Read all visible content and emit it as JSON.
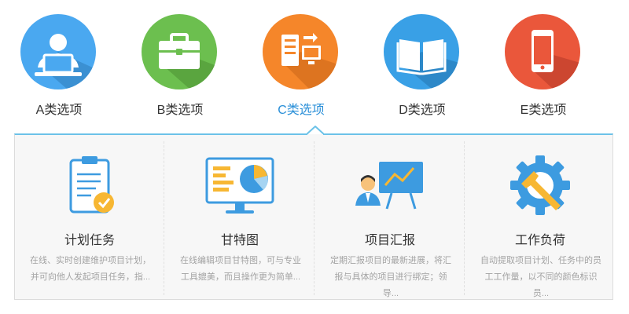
{
  "tabs": [
    {
      "label": "A类选项",
      "icon": "user-laptop-icon",
      "color": "#4aa8f0"
    },
    {
      "label": "B类选项",
      "icon": "briefcase-icon",
      "color": "#6cbf4f"
    },
    {
      "label": "C类选项",
      "icon": "server-monitor-icon",
      "color": "#f5862a",
      "active": true
    },
    {
      "label": "D类选项",
      "icon": "book-icon",
      "color": "#39a0e6"
    },
    {
      "label": "E类选项",
      "icon": "phone-icon",
      "color": "#ea573b"
    }
  ],
  "cards": [
    {
      "title": "计划任务",
      "desc": "在线、实时创建维护项目计划，并可向他人发起项目任务，指...",
      "icon": "clipboard-check-icon"
    },
    {
      "title": "甘特图",
      "desc": "在线编辑项目甘特图，可与专业工具媲美，而且操作更为简单...",
      "icon": "gantt-monitor-icon"
    },
    {
      "title": "项目汇报",
      "desc": "定期汇报项目的最新进展，将汇报与具体的项目进行绑定；领导...",
      "icon": "presentation-board-icon"
    },
    {
      "title": "工作负荷",
      "desc": "自动提取项目计划、任务中的员工工作量，以不同的颜色标识员...",
      "icon": "gear-wrench-icon"
    }
  ],
  "colors": {
    "accent": "#2a8fd8",
    "panel_border_top": "#6cc2e8"
  }
}
